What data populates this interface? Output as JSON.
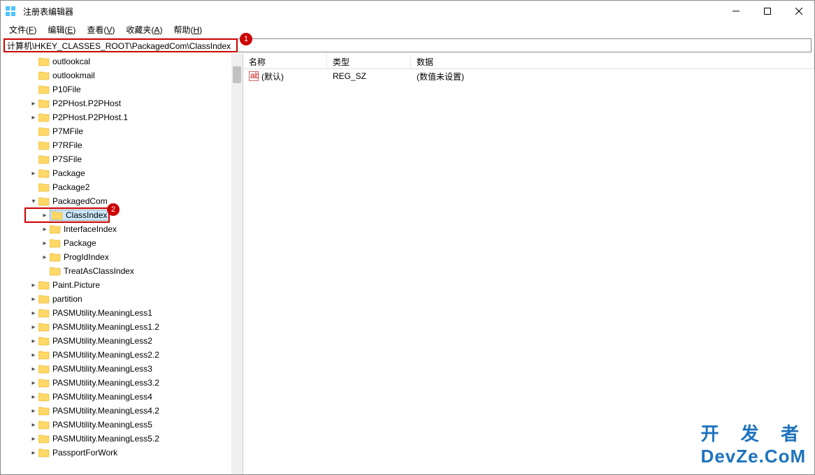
{
  "window": {
    "title": "注册表编辑器"
  },
  "menu": {
    "file": "文件",
    "file_k": "F",
    "edit": "编辑",
    "edit_k": "E",
    "view": "查看",
    "view_k": "V",
    "fav": "收藏夹",
    "fav_k": "A",
    "help": "帮助",
    "help_k": "H"
  },
  "address": "计算机\\HKEY_CLASSES_ROOT\\PackagedCom\\ClassIndex",
  "callouts": {
    "one": "1",
    "two": "2"
  },
  "tree": [
    {
      "indent": 2,
      "chev": "",
      "label": "outlookcal"
    },
    {
      "indent": 2,
      "chev": "",
      "label": "outlookmail"
    },
    {
      "indent": 2,
      "chev": "",
      "label": "P10File"
    },
    {
      "indent": 2,
      "chev": ">",
      "label": "P2PHost.P2PHost"
    },
    {
      "indent": 2,
      "chev": ">",
      "label": "P2PHost.P2PHost.1"
    },
    {
      "indent": 2,
      "chev": "",
      "label": "P7MFile"
    },
    {
      "indent": 2,
      "chev": "",
      "label": "P7RFile"
    },
    {
      "indent": 2,
      "chev": "",
      "label": "P7SFile"
    },
    {
      "indent": 2,
      "chev": ">",
      "label": "Package"
    },
    {
      "indent": 2,
      "chev": "",
      "label": "Package2"
    },
    {
      "indent": 2,
      "chev": "v",
      "label": "PackagedCom"
    },
    {
      "indent": 3,
      "chev": ">",
      "label": "ClassIndex",
      "selected": true,
      "annot2": true
    },
    {
      "indent": 3,
      "chev": ">",
      "label": "InterfaceIndex"
    },
    {
      "indent": 3,
      "chev": ">",
      "label": "Package"
    },
    {
      "indent": 3,
      "chev": ">",
      "label": "ProgIdIndex"
    },
    {
      "indent": 3,
      "chev": "",
      "label": "TreatAsClassIndex"
    },
    {
      "indent": 2,
      "chev": ">",
      "label": "Paint.Picture"
    },
    {
      "indent": 2,
      "chev": ">",
      "label": "partition"
    },
    {
      "indent": 2,
      "chev": ">",
      "label": "PASMUtility.MeaningLess1"
    },
    {
      "indent": 2,
      "chev": ">",
      "label": "PASMUtility.MeaningLess1.2"
    },
    {
      "indent": 2,
      "chev": ">",
      "label": "PASMUtility.MeaningLess2"
    },
    {
      "indent": 2,
      "chev": ">",
      "label": "PASMUtility.MeaningLess2.2"
    },
    {
      "indent": 2,
      "chev": ">",
      "label": "PASMUtility.MeaningLess3"
    },
    {
      "indent": 2,
      "chev": ">",
      "label": "PASMUtility.MeaningLess3.2"
    },
    {
      "indent": 2,
      "chev": ">",
      "label": "PASMUtility.MeaningLess4"
    },
    {
      "indent": 2,
      "chev": ">",
      "label": "PASMUtility.MeaningLess4.2"
    },
    {
      "indent": 2,
      "chev": ">",
      "label": "PASMUtility.MeaningLess5"
    },
    {
      "indent": 2,
      "chev": ">",
      "label": "PASMUtility.MeaningLess5.2"
    },
    {
      "indent": 2,
      "chev": ">",
      "label": "PassportForWork"
    }
  ],
  "columns": {
    "name": "名称",
    "type": "类型",
    "data": "数据"
  },
  "values": [
    {
      "name": "(默认)",
      "type": "REG_SZ",
      "data": "(数值未设置)"
    }
  ],
  "watermark": {
    "line1": "开 发 者",
    "line2": "DevZe.CoM"
  }
}
